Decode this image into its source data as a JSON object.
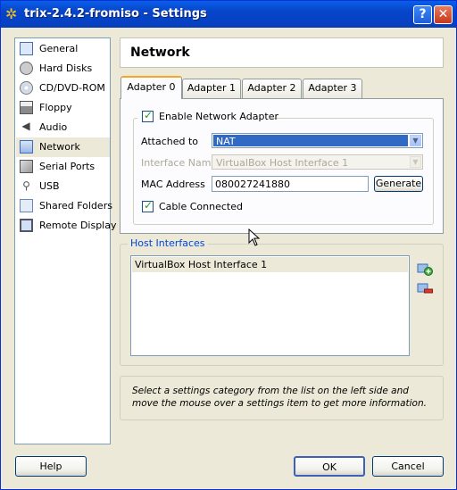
{
  "window": {
    "title": "trix-2.4.2-fromiso - Settings",
    "help_glyph": "?",
    "close_glyph": "✕"
  },
  "categories": [
    {
      "label": "General",
      "icon": "general-icon"
    },
    {
      "label": "Hard Disks",
      "icon": "hard-disk-icon"
    },
    {
      "label": "CD/DVD-ROM",
      "icon": "cd-dvd-icon"
    },
    {
      "label": "Floppy",
      "icon": "floppy-icon"
    },
    {
      "label": "Audio",
      "icon": "audio-icon"
    },
    {
      "label": "Network",
      "icon": "network-icon",
      "selected": true
    },
    {
      "label": "Serial Ports",
      "icon": "serial-ports-icon"
    },
    {
      "label": "USB",
      "icon": "usb-icon"
    },
    {
      "label": "Shared Folders",
      "icon": "shared-folders-icon"
    },
    {
      "label": "Remote Display",
      "icon": "remote-display-icon"
    }
  ],
  "page_title": "Network",
  "tabs": [
    {
      "label": "Adapter 0",
      "active": true
    },
    {
      "label": "Adapter 1"
    },
    {
      "label": "Adapter 2"
    },
    {
      "label": "Adapter 3"
    }
  ],
  "adapter": {
    "enable_label": "Enable Network Adapter",
    "enable_checked": true,
    "attached_to_label": "Attached to",
    "attached_to_value": "NAT",
    "interface_name_label": "Interface Name",
    "interface_name_value": "VirtualBox Host Interface 1",
    "mac_label": "MAC Address",
    "mac_value": "080027241880",
    "generate_label": "Generate",
    "cable_label": "Cable Connected",
    "cable_checked": true
  },
  "host_interfaces": {
    "legend": "Host Interfaces",
    "items": [
      "VirtualBox Host Interface 1"
    ]
  },
  "info_text": "Select a settings category from the list on the left side and move the mouse over a settings item to get more information.",
  "buttons": {
    "help": "Help",
    "ok": "OK",
    "cancel": "Cancel"
  },
  "colors": {
    "titlebar": "#0a5ee8",
    "selection": "#316ac5",
    "legend": "#0046d5"
  }
}
